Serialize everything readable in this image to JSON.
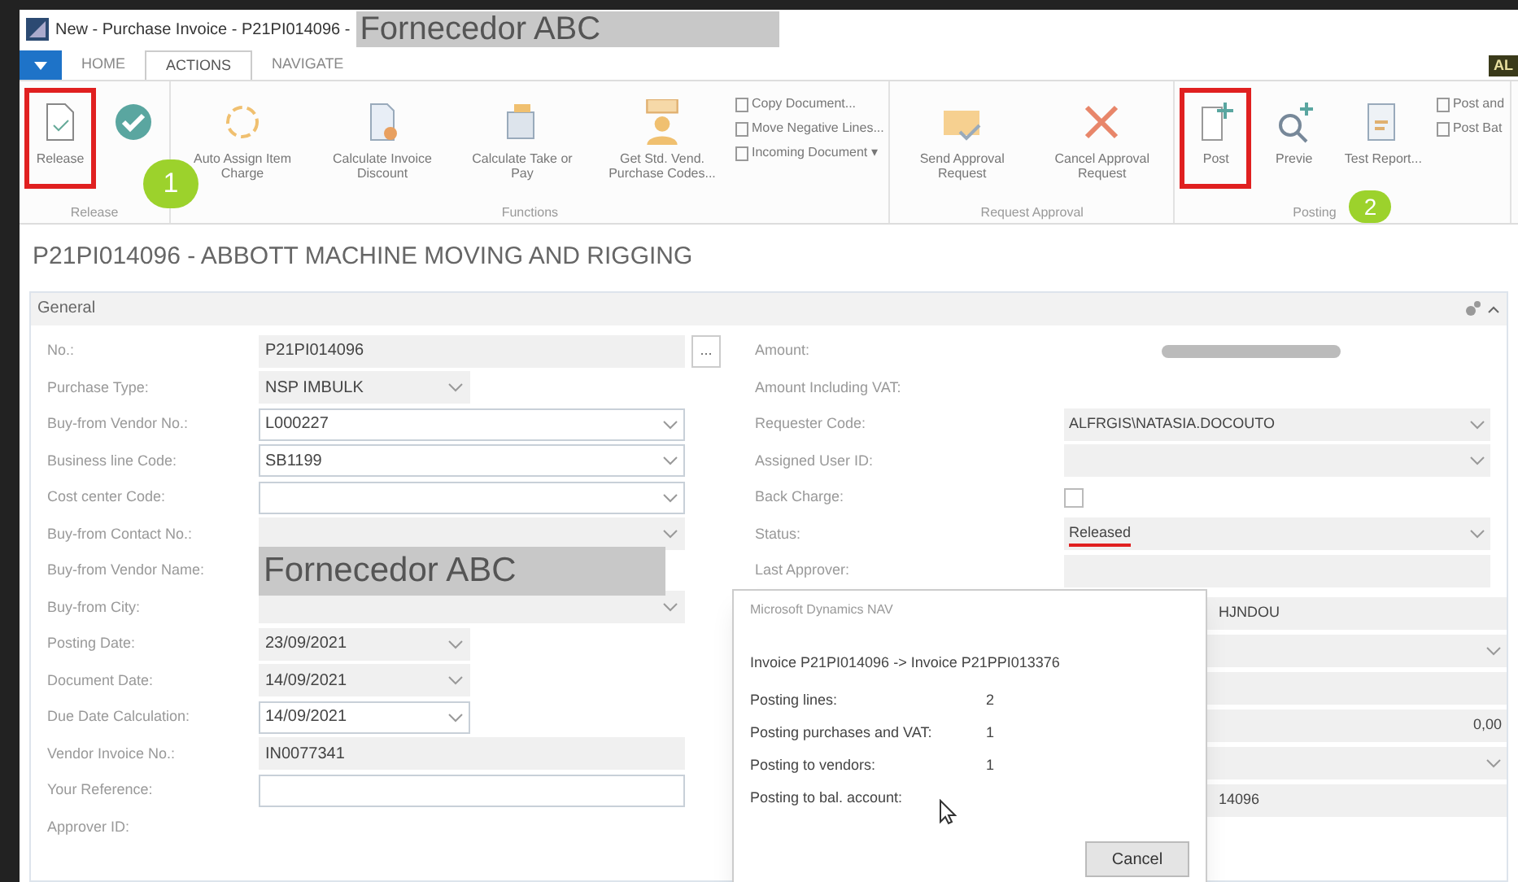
{
  "window": {
    "title": "New - Purchase Invoice - P21PI014096 -",
    "redaction": "Fornecedor ABC"
  },
  "tabs": [
    {
      "label": "HOME",
      "selected": false
    },
    {
      "label": "ACTIONS",
      "selected": true
    },
    {
      "label": "NAVIGATE",
      "selected": false
    }
  ],
  "user_badge": "AL",
  "ribbon": [
    {
      "group": "Release",
      "buttons": [
        {
          "label": "Release",
          "highlighted": true
        },
        {
          "highlighted": false
        }
      ]
    },
    {
      "group": "Functions",
      "buttons": [
        {
          "label": "Auto Assign Item Charge",
          "highlighted": false
        },
        {
          "label": "Calculate Invoice Discount",
          "highlighted": false
        },
        {
          "label": "Calculate Take or Pay",
          "highlighted": false
        },
        {
          "label": "Get Std. Vend. Purchase Codes...",
          "highlighted": false
        }
      ],
      "small": [
        "Copy Document...",
        "Move Negative Lines...",
        "Incoming Document ▾"
      ]
    },
    {
      "group": "Request Approval",
      "buttons": [
        {
          "label": "Send Approval Request",
          "highlighted": false
        },
        {
          "label": "Cancel Approval Request",
          "highlighted": false
        }
      ]
    },
    {
      "group": "Posting",
      "buttons": [
        {
          "label": "Post",
          "highlighted": true
        },
        {
          "label": "Previe",
          "highlighted": false
        },
        {
          "label": "Test Report...",
          "highlighted": false
        }
      ],
      "small": [
        "Post and",
        "Post Bat"
      ]
    }
  ],
  "step_badges": [
    "1",
    "2"
  ],
  "heading": "P21PI014096 - ABBOTT MACHINE MOVING AND RIGGING",
  "section": {
    "title": "General",
    "expanded": true
  },
  "left_fields": [
    {
      "label": "No.:",
      "value": "P21PI014096",
      "kind": "lookup",
      "lookup_label": "...",
      "editable": false
    },
    {
      "label": "Purchase Type:",
      "value": "NSP IMBULK",
      "kind": "short",
      "editable": false
    },
    {
      "label": "Buy-from Vendor No.:",
      "value": "L000227",
      "kind": "dropdown",
      "editable": true
    },
    {
      "label": "Business line Code:",
      "value": "SB1199",
      "kind": "dropdown",
      "editable": true
    },
    {
      "label": "Cost center Code:",
      "kind": "dropdown",
      "editable": true
    },
    {
      "label": "Buy-from Contact No.:",
      "kind": "dropdown",
      "editable": false
    },
    {
      "label": "Buy-from Vendor Name:",
      "value": "Fornecedor ABC",
      "kind": "redacted"
    },
    {
      "label": "Buy-from City:",
      "kind": "dropdown",
      "editable": false
    },
    {
      "label": "Posting Date:",
      "value": "23/09/2021",
      "kind": "short",
      "editable": false
    },
    {
      "label": "Document Date:",
      "value": "14/09/2021",
      "kind": "short",
      "editable": false
    },
    {
      "label": "Due Date Calculation:",
      "value": "14/09/2021",
      "kind": "short",
      "editable": true
    },
    {
      "label": "Vendor Invoice No.:",
      "value": "IN0077341",
      "kind": "text",
      "editable": false
    },
    {
      "label": "Your Reference:",
      "kind": "text",
      "editable": true
    },
    {
      "label": "Approver ID:",
      "kind": "none"
    }
  ],
  "right_fields": [
    {
      "label": "Amount:",
      "kind": "blurred"
    },
    {
      "label": "Amount Including VAT:",
      "kind": "none"
    },
    {
      "label": "Requester Code:",
      "value": "ALFRGIS\\NATASIA.DOCOUTO",
      "kind": "dropdown"
    },
    {
      "label": "Assigned User ID:",
      "kind": "dropdown"
    },
    {
      "label": "Back Charge:",
      "checked": false,
      "kind": "checkbox"
    },
    {
      "label": "Status:",
      "value": "Released",
      "kind": "dropdown",
      "underlined": true
    },
    {
      "label": "Last Approver:",
      "kind": "text"
    }
  ],
  "hidden_rows": [
    {
      "value": "HJNDOU",
      "kind": "text"
    },
    {
      "kind": "dropdown"
    },
    {
      "kind": "text"
    },
    {
      "value": "0,00",
      "kind": "number"
    },
    {
      "kind": "dropdown"
    },
    {
      "value": "14096",
      "kind": "text"
    }
  ],
  "dialog": {
    "title": "Microsoft Dynamics NAV",
    "message": "Invoice P21PI014096 -> Invoice P21PPI013376",
    "lines": [
      {
        "label": "Posting lines:",
        "value": "2"
      },
      {
        "label": "Posting purchases and VAT:",
        "value": "1"
      },
      {
        "label": "Posting to vendors:",
        "value": "1"
      },
      {
        "label": "Posting to bal. account:"
      }
    ],
    "button": "Cancel"
  }
}
